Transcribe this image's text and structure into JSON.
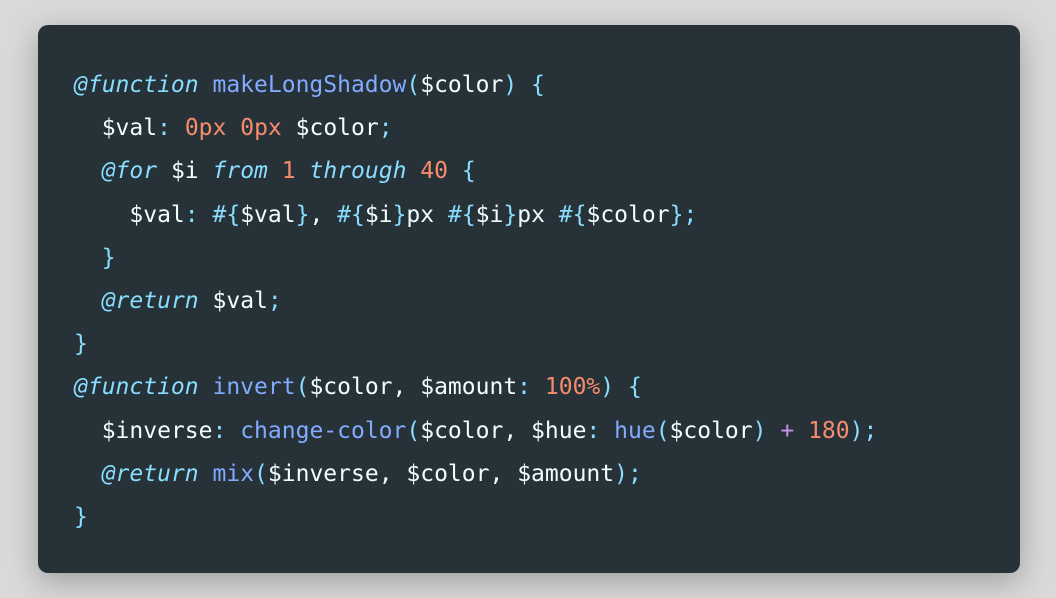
{
  "colors": {
    "background": "#d9d9d9",
    "editor_background": "#263238",
    "keyword": "#89ddff",
    "function": "#82aaff",
    "variable": "#eeffff",
    "number": "#f78c6c",
    "operator": "#c792ea"
  },
  "code": {
    "lines": [
      [
        {
          "t": "at-keyword",
          "v": "@function"
        },
        {
          "t": "text",
          "v": " "
        },
        {
          "t": "fn",
          "v": "makeLongShadow"
        },
        {
          "t": "punc",
          "v": "("
        },
        {
          "t": "var",
          "v": "$color"
        },
        {
          "t": "punc",
          "v": ")"
        },
        {
          "t": "text",
          "v": " "
        },
        {
          "t": "punc",
          "v": "{"
        }
      ],
      [
        {
          "t": "text",
          "v": "  "
        },
        {
          "t": "var",
          "v": "$val"
        },
        {
          "t": "punc",
          "v": ":"
        },
        {
          "t": "text",
          "v": " "
        },
        {
          "t": "num",
          "v": "0px"
        },
        {
          "t": "text",
          "v": " "
        },
        {
          "t": "num",
          "v": "0px"
        },
        {
          "t": "text",
          "v": " "
        },
        {
          "t": "var",
          "v": "$color"
        },
        {
          "t": "punc",
          "v": ";"
        }
      ],
      [
        {
          "t": "text",
          "v": "  "
        },
        {
          "t": "at-keyword",
          "v": "@for"
        },
        {
          "t": "text",
          "v": " "
        },
        {
          "t": "var",
          "v": "$i"
        },
        {
          "t": "text",
          "v": " "
        },
        {
          "t": "italic-keyword",
          "v": "from"
        },
        {
          "t": "text",
          "v": " "
        },
        {
          "t": "num",
          "v": "1"
        },
        {
          "t": "text",
          "v": " "
        },
        {
          "t": "italic-keyword",
          "v": "through"
        },
        {
          "t": "text",
          "v": " "
        },
        {
          "t": "num",
          "v": "40"
        },
        {
          "t": "text",
          "v": " "
        },
        {
          "t": "punc",
          "v": "{"
        }
      ],
      [
        {
          "t": "text",
          "v": "    "
        },
        {
          "t": "var",
          "v": "$val"
        },
        {
          "t": "punc",
          "v": ":"
        },
        {
          "t": "text",
          "v": " "
        },
        {
          "t": "punc",
          "v": "#{"
        },
        {
          "t": "var",
          "v": "$val"
        },
        {
          "t": "punc",
          "v": "}"
        },
        {
          "t": "text",
          "v": ", "
        },
        {
          "t": "punc",
          "v": "#{"
        },
        {
          "t": "var",
          "v": "$i"
        },
        {
          "t": "punc",
          "v": "}"
        },
        {
          "t": "text",
          "v": "px "
        },
        {
          "t": "punc",
          "v": "#{"
        },
        {
          "t": "var",
          "v": "$i"
        },
        {
          "t": "punc",
          "v": "}"
        },
        {
          "t": "text",
          "v": "px "
        },
        {
          "t": "punc",
          "v": "#{"
        },
        {
          "t": "var",
          "v": "$color"
        },
        {
          "t": "punc",
          "v": "};"
        }
      ],
      [
        {
          "t": "text",
          "v": "  "
        },
        {
          "t": "punc",
          "v": "}"
        }
      ],
      [
        {
          "t": "text",
          "v": "  "
        },
        {
          "t": "at-keyword",
          "v": "@return"
        },
        {
          "t": "text",
          "v": " "
        },
        {
          "t": "var",
          "v": "$val"
        },
        {
          "t": "punc",
          "v": ";"
        }
      ],
      [
        {
          "t": "punc",
          "v": "}"
        }
      ],
      [
        {
          "t": "at-keyword",
          "v": "@function"
        },
        {
          "t": "text",
          "v": " "
        },
        {
          "t": "fn",
          "v": "invert"
        },
        {
          "t": "punc",
          "v": "("
        },
        {
          "t": "var",
          "v": "$color"
        },
        {
          "t": "text",
          "v": ", "
        },
        {
          "t": "var",
          "v": "$amount"
        },
        {
          "t": "punc",
          "v": ":"
        },
        {
          "t": "text",
          "v": " "
        },
        {
          "t": "num",
          "v": "100%"
        },
        {
          "t": "punc",
          "v": ")"
        },
        {
          "t": "text",
          "v": " "
        },
        {
          "t": "punc",
          "v": "{"
        }
      ],
      [
        {
          "t": "text",
          "v": "  "
        },
        {
          "t": "var",
          "v": "$inverse"
        },
        {
          "t": "punc",
          "v": ":"
        },
        {
          "t": "text",
          "v": " "
        },
        {
          "t": "fn",
          "v": "change-color"
        },
        {
          "t": "punc",
          "v": "("
        },
        {
          "t": "var",
          "v": "$color"
        },
        {
          "t": "text",
          "v": ", "
        },
        {
          "t": "var",
          "v": "$hue"
        },
        {
          "t": "punc",
          "v": ":"
        },
        {
          "t": "text",
          "v": " "
        },
        {
          "t": "fn",
          "v": "hue"
        },
        {
          "t": "punc",
          "v": "("
        },
        {
          "t": "var",
          "v": "$color"
        },
        {
          "t": "punc",
          "v": ")"
        },
        {
          "t": "text",
          "v": " "
        },
        {
          "t": "op",
          "v": "+"
        },
        {
          "t": "text",
          "v": " "
        },
        {
          "t": "num",
          "v": "180"
        },
        {
          "t": "punc",
          "v": ");"
        }
      ],
      [
        {
          "t": "text",
          "v": "  "
        },
        {
          "t": "at-keyword",
          "v": "@return"
        },
        {
          "t": "text",
          "v": " "
        },
        {
          "t": "fn",
          "v": "mix"
        },
        {
          "t": "punc",
          "v": "("
        },
        {
          "t": "var",
          "v": "$inverse"
        },
        {
          "t": "text",
          "v": ", "
        },
        {
          "t": "var",
          "v": "$color"
        },
        {
          "t": "text",
          "v": ", "
        },
        {
          "t": "var",
          "v": "$amount"
        },
        {
          "t": "punc",
          "v": ");"
        }
      ],
      [
        {
          "t": "punc",
          "v": "}"
        }
      ]
    ]
  }
}
